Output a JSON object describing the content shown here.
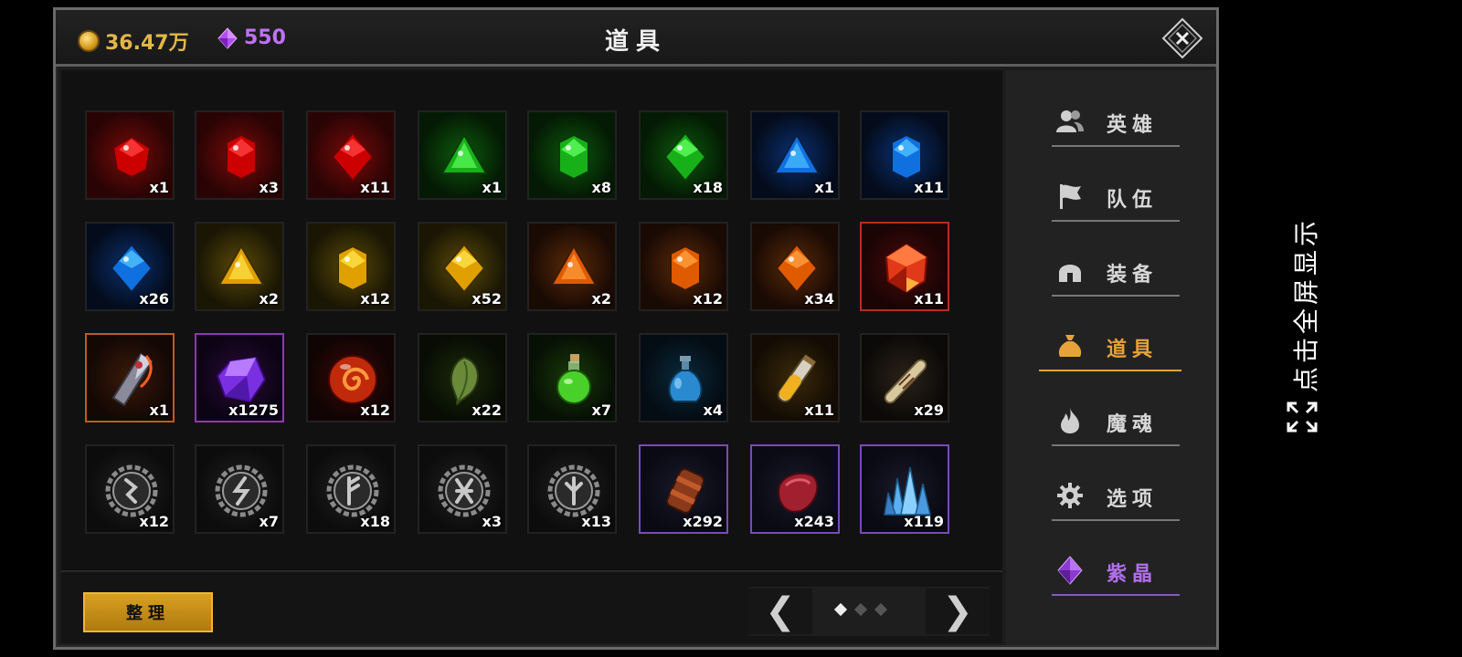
{
  "header": {
    "gold_amount": "36.47万",
    "crystal_amount": "550",
    "title": "道具",
    "close_icon": "close-icon"
  },
  "colors": {
    "gold": "#e3b64a",
    "purple": "#c070ff",
    "active_tab": "#e8a23a"
  },
  "items": [
    {
      "name": "red-gem-small",
      "count": "x1"
    },
    {
      "name": "red-gem-medium",
      "count": "x3"
    },
    {
      "name": "red-gem-large",
      "count": "x11"
    },
    {
      "name": "green-gem-small",
      "count": "x1"
    },
    {
      "name": "green-gem-medium",
      "count": "x8"
    },
    {
      "name": "green-gem-large",
      "count": "x18"
    },
    {
      "name": "blue-gem-small",
      "count": "x1"
    },
    {
      "name": "blue-gem-medium",
      "count": "x11"
    },
    {
      "name": "blue-gem-large",
      "count": "x26"
    },
    {
      "name": "yellow-gem-small",
      "count": "x2"
    },
    {
      "name": "yellow-gem-medium",
      "count": "x12"
    },
    {
      "name": "yellow-gem-large",
      "count": "x52"
    },
    {
      "name": "orange-gem-small",
      "count": "x2"
    },
    {
      "name": "orange-gem-medium",
      "count": "x12"
    },
    {
      "name": "orange-gem-large",
      "count": "x34"
    },
    {
      "name": "fire-crystal",
      "count": "x11"
    },
    {
      "name": "blade-shard",
      "count": "x1"
    },
    {
      "name": "purple-crystal",
      "count": "x1275"
    },
    {
      "name": "fire-orb",
      "count": "x12"
    },
    {
      "name": "herb-pod",
      "count": "x22"
    },
    {
      "name": "green-potion",
      "count": "x7"
    },
    {
      "name": "blue-potion",
      "count": "x4"
    },
    {
      "name": "gold-vial",
      "count": "x11"
    },
    {
      "name": "scroll",
      "count": "x29"
    },
    {
      "name": "rune-1",
      "count": "x12"
    },
    {
      "name": "rune-2",
      "count": "x7"
    },
    {
      "name": "rune-3",
      "count": "x18"
    },
    {
      "name": "rune-4",
      "count": "x3"
    },
    {
      "name": "rune-5",
      "count": "x13"
    },
    {
      "name": "leather-bracer",
      "count": "x292"
    },
    {
      "name": "red-ore",
      "count": "x243"
    },
    {
      "name": "ice-crystal",
      "count": "x119"
    }
  ],
  "footer": {
    "sort_label": "整理",
    "prev_arrow": "❮",
    "next_arrow": "❯",
    "current_page": 1,
    "total_pages": 3
  },
  "sidebar": {
    "items": [
      {
        "label": "英雄",
        "icon": "heroes-icon"
      },
      {
        "label": "队伍",
        "icon": "flag-icon"
      },
      {
        "label": "装备",
        "icon": "helmet-icon"
      },
      {
        "label": "道具",
        "icon": "bag-icon",
        "active": true
      },
      {
        "label": "魔魂",
        "icon": "flame-icon"
      },
      {
        "label": "选项",
        "icon": "gear-icon"
      },
      {
        "label": "紫晶",
        "icon": "purple-crystal-icon"
      }
    ]
  },
  "overlay": {
    "fullscreen_text": "点击全屏显示",
    "fullscreen_icon": "expand-icon"
  }
}
